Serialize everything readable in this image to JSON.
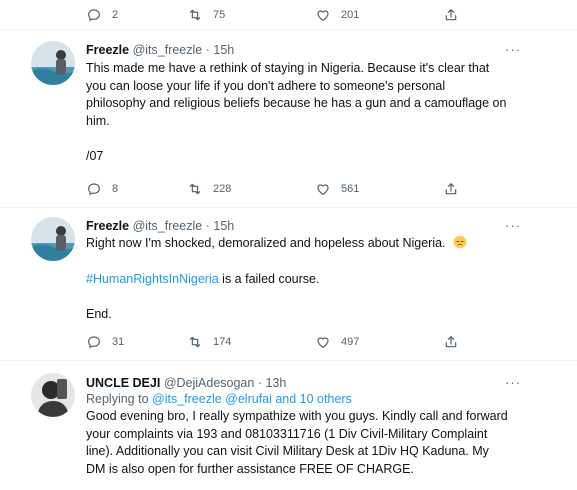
{
  "top_actions": {
    "replies": "2",
    "retweets": "75",
    "likes": "201"
  },
  "tweets": [
    {
      "name": "Freezle",
      "handle": "@its_freezle",
      "dot": "·",
      "time": "15h",
      "more": "···",
      "lines": [
        "This made me have a rethink of staying in Nigeria. Because it's clear that",
        "you can loose your life if you don't adhere to someone's personal",
        "philosophy and religious beliefs because he has a gun and a camouflage on",
        "him."
      ],
      "footer": "/07",
      "replies": "8",
      "retweets": "228",
      "likes": "561"
    },
    {
      "name": "Freezle",
      "handle": "@its_freezle",
      "dot": "·",
      "time": "15h",
      "more": "···",
      "line1": "Right now I'm shocked, demoralized and hopeless about Nigeria.",
      "emoji": "pensive-face-emoji",
      "hashtag": "#HumanRightsInNigeria",
      "hashtag_rest": " is a failed course.",
      "end": "End.",
      "replies": "31",
      "retweets": "174",
      "likes": "497"
    },
    {
      "name": "UNCLE DEJI",
      "handle": "@DejiAdesogan",
      "dot": "·",
      "time": "13h",
      "more": "···",
      "replying_prefix": "Replying to ",
      "replying_users": "@its_freezle @elrufai and 10 others",
      "lines": [
        "Good evening bro, I really sympathize with you guys. Kindly call and forward",
        "your complaints via 193 and 08103311716 (1 Div Civil-Military Complaint",
        "line). Additionally you can visit Civil Military Desk at 1Div HQ Kaduna. My",
        "DM is also open for further assistance FREE OF CHARGE."
      ]
    }
  ],
  "colors": {
    "accent": "#1d9bf0",
    "muted": "#536471",
    "text": "#0f1419",
    "divider": "#eff3f4"
  }
}
